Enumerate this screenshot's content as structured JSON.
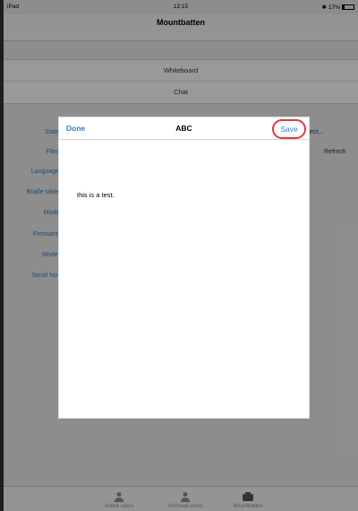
{
  "status_bar": {
    "carrier": "iPad",
    "time": "12:15",
    "battery": "17%",
    "battery_level": 0.17
  },
  "navigation": {
    "title": "Mountbatten"
  },
  "menu_group": {
    "items": [
      "Whiteboard",
      "Chat"
    ]
  },
  "details": {
    "labels": [
      "State:",
      "Files:",
      "Language:",
      "Braille table:",
      "Mode:",
      "Firmware:",
      "Model:",
      "Serial No.:"
    ],
    "peek_right_top": "ect...",
    "peek_right_refresh": "Refresh"
  },
  "modal": {
    "done_label": "Done",
    "title": "ABC",
    "save_label": "Save",
    "body_text": "this is a test."
  },
  "tabbar": {
    "tabs": [
      {
        "label": "Active users",
        "icon": "person-icon"
      },
      {
        "label": "Archived users",
        "icon": "person-icon"
      },
      {
        "label": "Mountbatten",
        "icon": "device-icon"
      }
    ]
  }
}
